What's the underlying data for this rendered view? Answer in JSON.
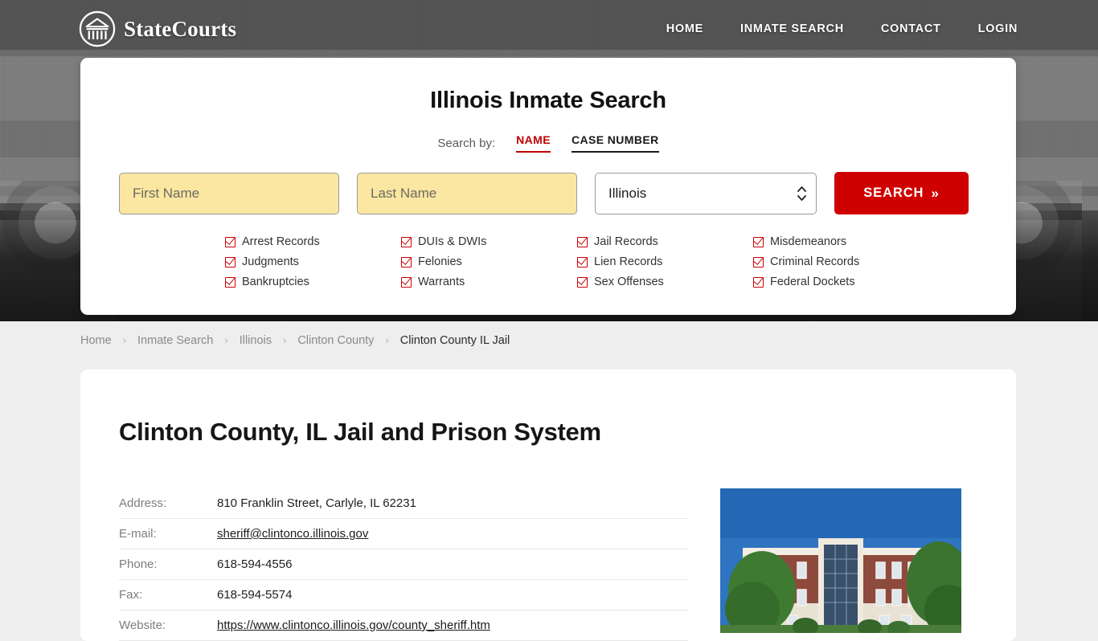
{
  "brand": {
    "name": "StateCourts",
    "logo_icon": "courthouse-circle-icon"
  },
  "nav": {
    "items": [
      {
        "label": "HOME"
      },
      {
        "label": "INMATE SEARCH"
      },
      {
        "label": "CONTACT"
      },
      {
        "label": "LOGIN"
      }
    ]
  },
  "search_card": {
    "title": "Illinois Inmate Search",
    "search_by_label": "Search by:",
    "tabs": [
      {
        "label": "NAME",
        "active": true
      },
      {
        "label": "CASE NUMBER",
        "active": false
      }
    ],
    "first_name": {
      "placeholder": "First Name",
      "value": ""
    },
    "last_name": {
      "placeholder": "Last Name",
      "value": ""
    },
    "state_select": {
      "value": "Illinois",
      "options": [
        "Illinois"
      ]
    },
    "submit_label": "SEARCH",
    "submit_chevron": "»",
    "accent_red": "#cf0000",
    "field_yellow": "#fbe7a2",
    "record_types": [
      "Arrest Records",
      "DUIs & DWIs",
      "Jail Records",
      "Misdemeanors",
      "Judgments",
      "Felonies",
      "Lien Records",
      "Criminal Records",
      "Bankruptcies",
      "Warrants",
      "Sex Offenses",
      "Federal Dockets"
    ]
  },
  "breadcrumb": {
    "separator": "›",
    "items": [
      {
        "label": "Home",
        "current": false
      },
      {
        "label": "Inmate Search",
        "current": false
      },
      {
        "label": "Illinois",
        "current": false
      },
      {
        "label": "Clinton County",
        "current": false
      },
      {
        "label": "Clinton County IL Jail",
        "current": true
      }
    ]
  },
  "page": {
    "title": "Clinton County, IL Jail and Prison System",
    "details": [
      {
        "label": "Address:",
        "value": "810 Franklin Street, Carlyle, IL 62231",
        "link": false
      },
      {
        "label": "E-mail:",
        "value": "sheriff@clintonco.illinois.gov",
        "link": true
      },
      {
        "label": "Phone:",
        "value": "618-594-4556",
        "link": false
      },
      {
        "label": "Fax:",
        "value": "618-594-5574",
        "link": false
      },
      {
        "label": "Website:",
        "value": "https://www.clintonco.illinois.gov/county_sheriff.htm",
        "link": true
      }
    ],
    "photo_alt": "clinton-county-courthouse-photo"
  }
}
